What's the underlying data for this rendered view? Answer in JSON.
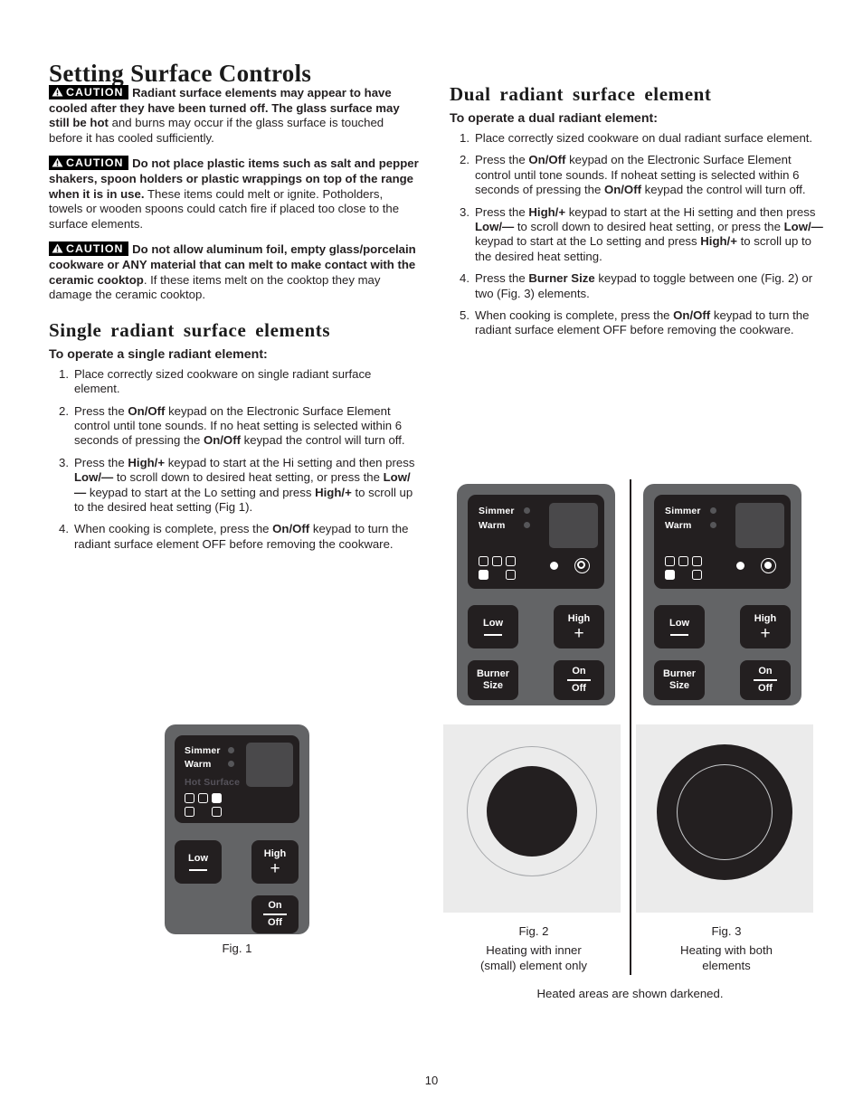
{
  "page": {
    "title": "Setting Surface Controls",
    "number": "10"
  },
  "left_column": {
    "cautions": [
      {
        "badge": "CAUTION",
        "bold_text": "Radiant surface elements may appear to have cooled after they have been turned off. The glass surface may still be hot",
        "rest_text": " and burns may occur if the glass surface is touched before it has cooled sufficiently."
      },
      {
        "badge": "CAUTION",
        "bold_text": "Do not place plastic items such as salt and pepper shakers, spoon holders or plastic wrappings on top of the range when it is in use.",
        "rest_text": " These items could melt or ignite. Potholders, towels or wooden spoons could catch fire if placed too close to the surface elements."
      },
      {
        "badge": "CAUTION",
        "bold_text": "Do not allow aluminum foil, empty glass/porcelain cookware or ANY material that can melt to make contact with the ceramic cooktop",
        "rest_text": ". If these items melt on the cooktop they may damage the ceramic cooktop."
      }
    ],
    "section_heading": "Single radiant surface elements",
    "sub_heading": "To operate a single radiant element:",
    "steps": [
      {
        "num": "1.",
        "parts": [
          {
            "t": "Place correctly sized cookware on single radiant surface element.",
            "b": false
          }
        ]
      },
      {
        "num": "2.",
        "parts": [
          {
            "t": "Press the ",
            "b": false
          },
          {
            "t": "On/Off",
            "b": true
          },
          {
            "t": " keypad on the Electronic Surface Element control until tone sounds. If no heat setting is selected within 6 seconds of pressing the ",
            "b": false
          },
          {
            "t": "On/Off",
            "b": true
          },
          {
            "t": " keypad the control will turn off.",
            "b": false
          }
        ]
      },
      {
        "num": "3.",
        "parts": [
          {
            "t": "Press the ",
            "b": false
          },
          {
            "t": "High/+",
            "b": true
          },
          {
            "t": " keypad to start at the Hi setting and then press ",
            "b": false
          },
          {
            "t": "Low/—",
            "b": true
          },
          {
            "t": " to scroll down to desired heat setting, or press the ",
            "b": false
          },
          {
            "t": "Low/—",
            "b": true
          },
          {
            "t": " keypad to start at the Lo setting and press ",
            "b": false
          },
          {
            "t": "High/+",
            "b": true
          },
          {
            "t": " to scroll up to the desired heat setting (Fig 1).",
            "b": false
          }
        ]
      },
      {
        "num": "4.",
        "parts": [
          {
            "t": "When cooking is complete, press the ",
            "b": false
          },
          {
            "t": "On/Off",
            "b": true
          },
          {
            "t": " keypad to turn the radiant surface element OFF before removing the cookware.",
            "b": false
          }
        ]
      }
    ]
  },
  "right_column": {
    "section_heading": "Dual radiant surface element",
    "sub_heading": "To operate a dual radiant element:",
    "steps": [
      {
        "num": "1.",
        "parts": [
          {
            "t": "Place correctly sized cookware on dual radiant surface element.",
            "b": false
          }
        ]
      },
      {
        "num": "2.",
        "parts": [
          {
            "t": "Press the ",
            "b": false
          },
          {
            "t": "On/Off",
            "b": true
          },
          {
            "t": " keypad on the Electronic Surface Element control until tone sounds. If noheat setting is selected within 6 seconds of pressing the ",
            "b": false
          },
          {
            "t": "On/Off",
            "b": true
          },
          {
            "t": " keypad the control will turn off.",
            "b": false
          }
        ]
      },
      {
        "num": "3.",
        "parts": [
          {
            "t": "Press the ",
            "b": false
          },
          {
            "t": "High/+",
            "b": true
          },
          {
            "t": " keypad to start at the Hi setting and then press ",
            "b": false
          },
          {
            "t": "Low/—",
            "b": true
          },
          {
            "t": " to scroll down to desired heat setting, or press the ",
            "b": false
          },
          {
            "t": "Low/—",
            "b": true
          },
          {
            "t": " keypad to start at the Lo setting and press ",
            "b": false
          },
          {
            "t": "High/+",
            "b": true
          },
          {
            "t": " to scroll up to the desired heat setting.",
            "b": false
          }
        ]
      },
      {
        "num": "4.",
        "parts": [
          {
            "t": "Press the ",
            "b": false
          },
          {
            "t": "Burner Size",
            "b": true
          },
          {
            "t": " keypad to toggle between one (Fig. 2) or two (Fig. 3) elements.",
            "b": false
          }
        ]
      },
      {
        "num": "5.",
        "parts": [
          {
            "t": "When cooking is complete, press the ",
            "b": false
          },
          {
            "t": "On/Off",
            "b": true
          },
          {
            "t": " keypad to turn the radiant surface element OFF before removing the cookware.",
            "b": false
          }
        ]
      }
    ]
  },
  "figures": {
    "fig1": {
      "caption": "Fig. 1",
      "panel": {
        "indicator_simmer": "Simmer",
        "indicator_warm": "Warm",
        "indicator_hot_surface": "Hot Surface",
        "key_low_label": "Low",
        "key_high_label": "High",
        "key_on": "On",
        "key_off": "Off"
      }
    },
    "fig2": {
      "caption": "Fig. 2",
      "description_line1": "Heating with inner",
      "description_line2": "(small) element only",
      "panel": {
        "indicator_simmer": "Simmer",
        "indicator_warm": "Warm",
        "key_low_label": "Low",
        "key_high_label": "High",
        "key_burner_line1": "Burner",
        "key_burner_line2": "Size",
        "key_on": "On",
        "key_off": "Off"
      }
    },
    "fig3": {
      "caption": "Fig. 3",
      "description_line1": "Heating with both",
      "description_line2": "elements",
      "panel": {
        "indicator_simmer": "Simmer",
        "indicator_warm": "Warm",
        "key_low_label": "Low",
        "key_high_label": "High",
        "key_burner_line1": "Burner",
        "key_burner_line2": "Size",
        "key_on": "On",
        "key_off": "Off"
      }
    },
    "note": "Heated areas are shown darkened."
  },
  "colors": {
    "panel_body": "#636466",
    "panel_screen": "#231f20",
    "key_face": "#231f20",
    "burner_bg": "#ebebeb",
    "burner_dark": "#231f20",
    "text": "#231f20"
  }
}
